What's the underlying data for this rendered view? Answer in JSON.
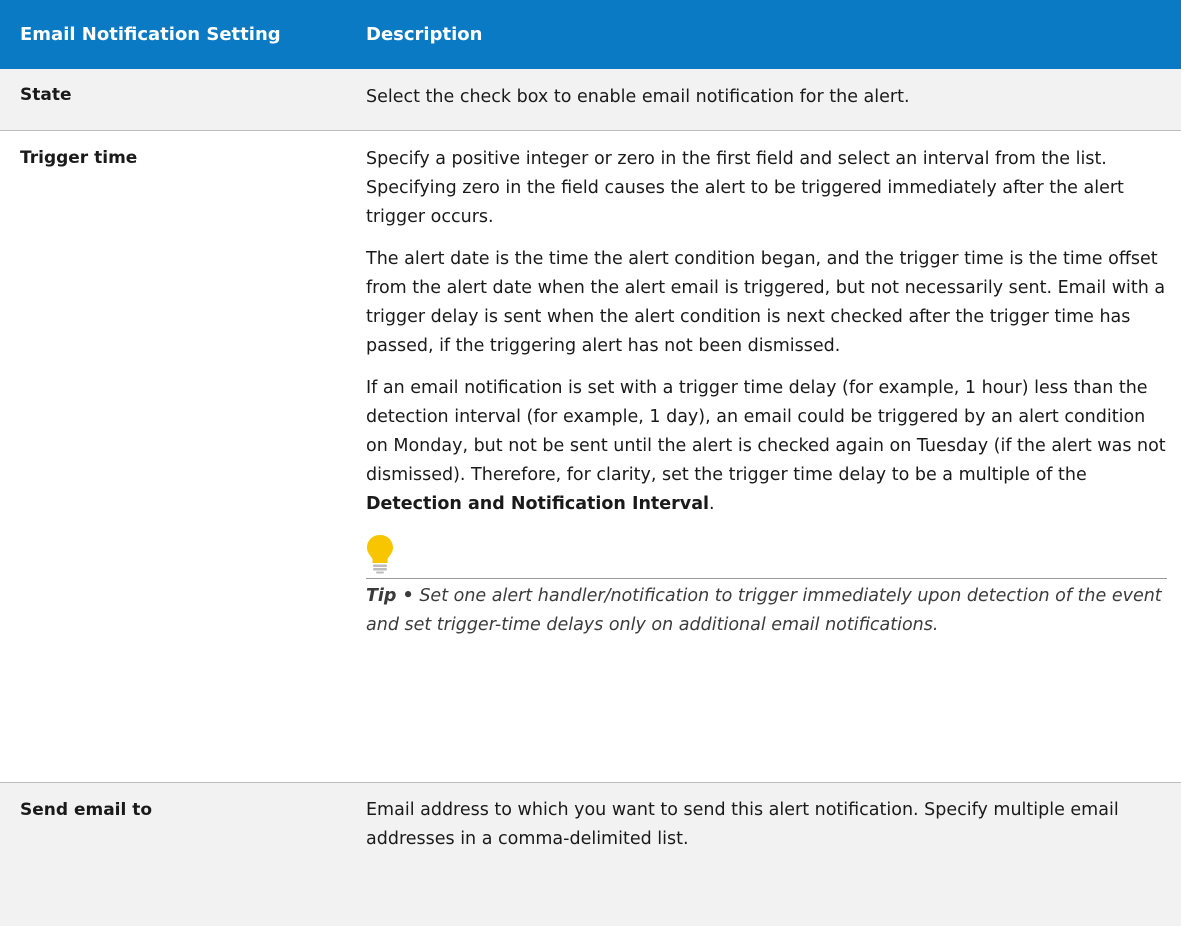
{
  "header": {
    "col1": "Email Notification Setting",
    "col2": "Description"
  },
  "rows": [
    {
      "setting": "State",
      "description": [
        "Select the check box to enable email notification for the alert."
      ]
    },
    {
      "setting": "Trigger time",
      "description": [
        "Specify a positive integer or zero in the first field and select an interval from the list. Specifying zero in the field causes the alert to be triggered immediately after the alert trigger occurs.",
        "The alert date is the time the alert condition began, and the trigger time is the time offset from the alert date when the alert email is triggered, but not necessarily sent. Email with a trigger delay is sent when the alert condition is next checked after the trigger time has passed, if the triggering alert has not been dismissed.",
        "If an email notification is set with a trigger time delay (for example, 1 hour) less than the detection interval (for example, 1 day), an email could be triggered by an alert condition on Monday, but not be sent until the alert is checked again on Tuesday (if the alert was not dismissed). Therefore, for clarity, set the trigger time delay to be a multiple of the"
      ],
      "bold_ref": "Detection and Notification Interval",
      "after_ref": ".",
      "tip_label": "Tip •",
      "tip_text": "Set one alert handler/notification to trigger immediately upon detection of the event and set trigger-time delays only on additional email notifications.",
      "tip_icon": "lightbulb-icon",
      "tip_icon_color": "#f7c600"
    },
    {
      "setting": "Send email to",
      "description": [
        "Email address to which you want to send this alert notification. Specify multiple email addresses in a comma-delimited list."
      ]
    }
  ],
  "colors": {
    "header_bg": "#0a7ac4",
    "alt_row_bg": "#f2f2f2"
  }
}
